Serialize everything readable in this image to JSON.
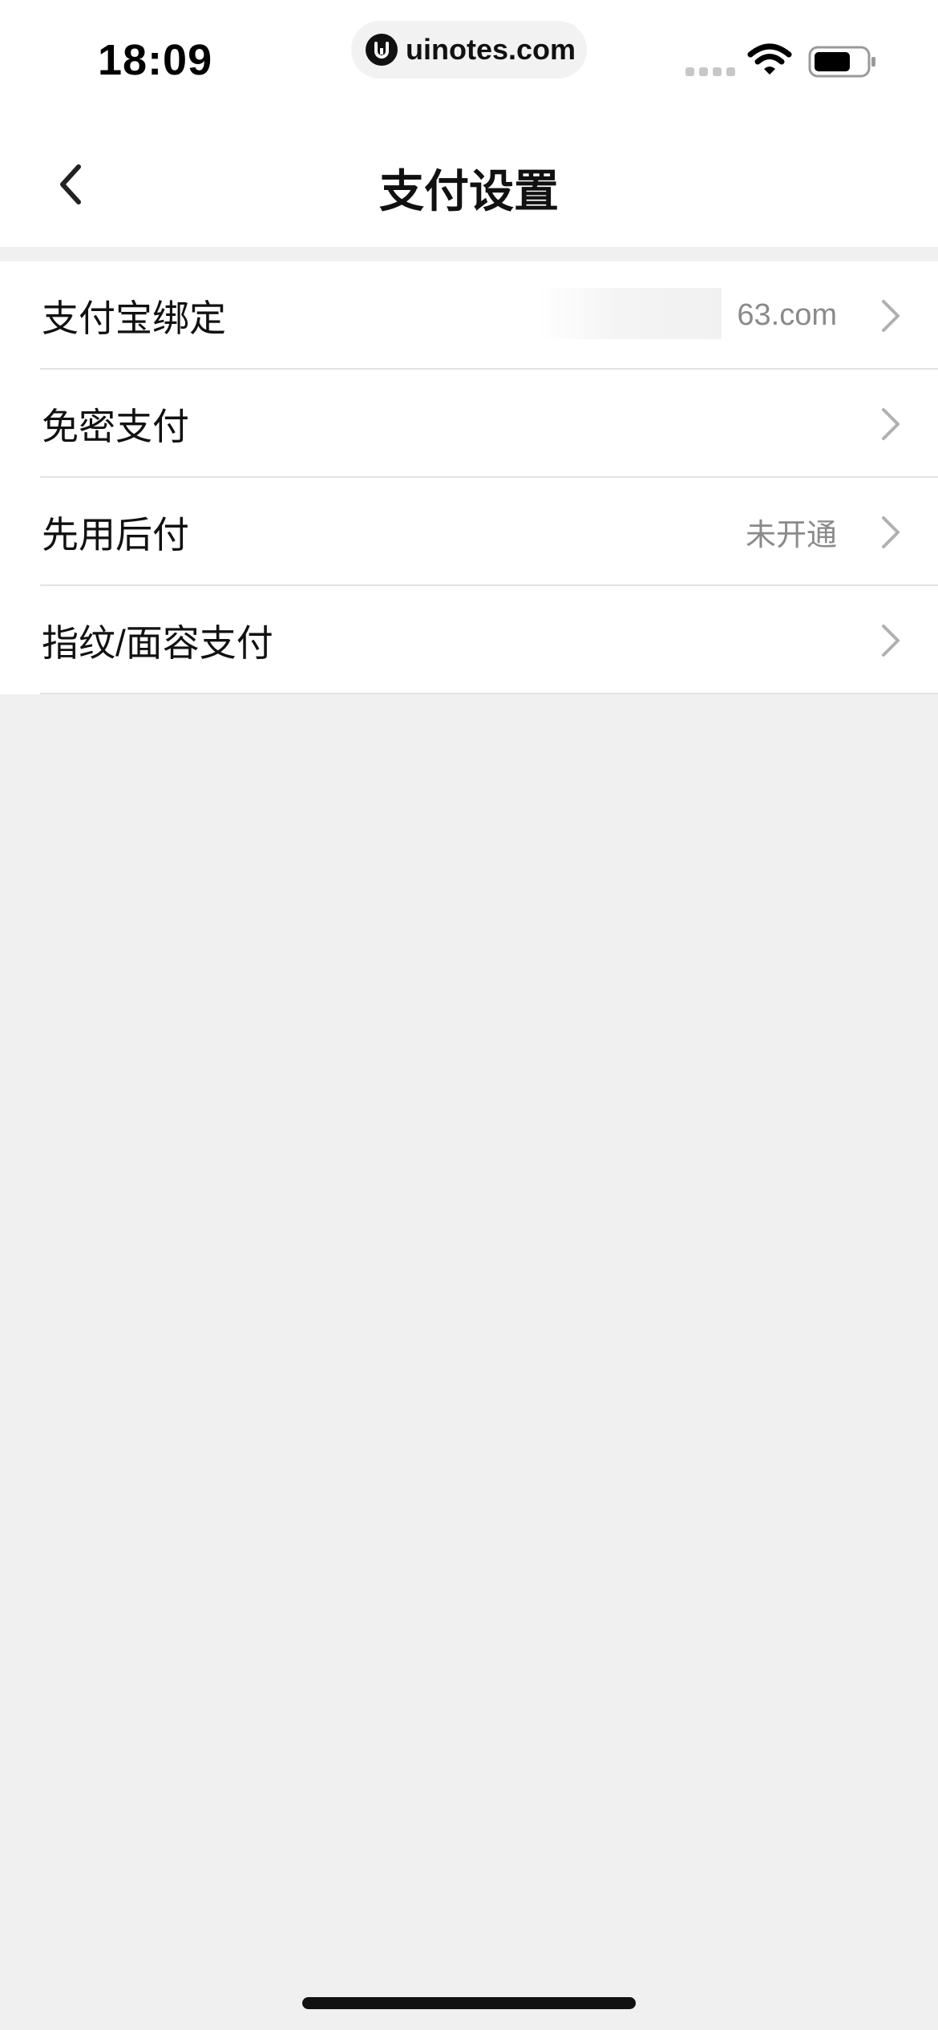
{
  "status_bar": {
    "time": "18:09",
    "url": "uinotes.com",
    "icons": [
      "signal-dots-icon",
      "wifi-icon",
      "battery-icon"
    ]
  },
  "nav": {
    "title": "支付设置",
    "back_icon": "chevron-left-icon"
  },
  "settings": {
    "items": [
      {
        "label": "支付宝绑定",
        "value": "63.com",
        "icon": "chevron-right-icon"
      },
      {
        "label": "免密支付",
        "value": "",
        "icon": "chevron-right-icon"
      },
      {
        "label": "先用后付",
        "value": "未开通",
        "icon": "chevron-right-icon"
      },
      {
        "label": "指纹/面容支付",
        "value": "",
        "icon": "chevron-right-icon"
      }
    ]
  },
  "colors": {
    "background": "#f0f0f0",
    "surface": "#ffffff",
    "text_primary": "#111111",
    "text_secondary": "#8a8a8a",
    "chevron": "#b0b0b0",
    "divider": "#e2e2e2"
  }
}
